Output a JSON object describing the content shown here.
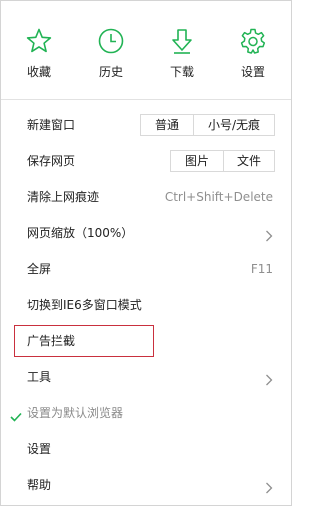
{
  "top_buttons": [
    {
      "label": "收藏",
      "icon": "star-icon"
    },
    {
      "label": "历史",
      "icon": "clock-icon"
    },
    {
      "label": "下载",
      "icon": "download-icon"
    },
    {
      "label": "设置",
      "icon": "gear-icon"
    }
  ],
  "menu": {
    "new_window": {
      "label": "新建窗口",
      "options": [
        "普通",
        "小号/无痕"
      ]
    },
    "save_page": {
      "label": "保存网页",
      "options": [
        "图片",
        "文件"
      ]
    },
    "clear_traces": {
      "label": "清除上网痕迹",
      "shortcut": "Ctrl+Shift+Delete"
    },
    "zoom": {
      "label": "网页缩放（100%）"
    },
    "fullscreen": {
      "label": "全屏",
      "shortcut": "F11"
    },
    "ie6_mode": {
      "label": "切换到IE6多窗口模式"
    },
    "ad_block": {
      "label": "广告拦截"
    },
    "tools": {
      "label": "工具"
    },
    "default_browser": {
      "label": "设置为默认浏览器",
      "checked": true
    },
    "settings": {
      "label": "设置"
    },
    "help": {
      "label": "帮助"
    }
  },
  "colors": {
    "accent": "#21b354",
    "highlight_border": "#c9303e"
  }
}
